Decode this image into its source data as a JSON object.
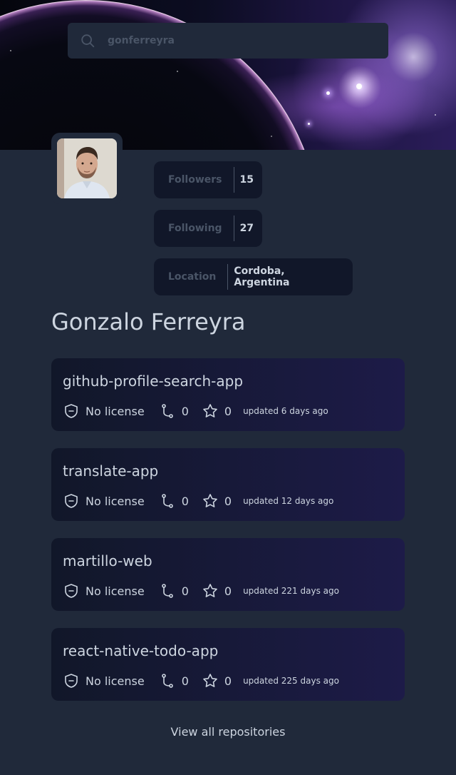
{
  "search": {
    "value": "gonferreyra",
    "placeholder": "gonferreyra"
  },
  "profile": {
    "name": "Gonzalo Ferreyra",
    "stats": [
      {
        "label": "Followers",
        "value": "15"
      },
      {
        "label": "Following",
        "value": "27"
      },
      {
        "label": "Location",
        "value": "Cordoba, Argentina"
      }
    ]
  },
  "repos": [
    {
      "name": "github-profile-search-app",
      "license": "No license",
      "forks": "0",
      "stars": "0",
      "updated": "updated 6 days ago"
    },
    {
      "name": "translate-app",
      "license": "No license",
      "forks": "0",
      "stars": "0",
      "updated": "updated 12 days ago"
    },
    {
      "name": "martillo-web",
      "license": "No license",
      "forks": "0",
      "stars": "0",
      "updated": "updated 221 days ago"
    },
    {
      "name": "react-native-todo-app",
      "license": "No license",
      "forks": "0",
      "stars": "0",
      "updated": "updated 225 days ago"
    }
  ],
  "footer": {
    "view_all": "View all repositories"
  },
  "colors": {
    "background": "#20293a",
    "card": "#111729",
    "card_gradient_end": "#1d1b48",
    "text": "#cdd5e0",
    "muted": "#4a5567"
  },
  "icons": {
    "search": "search-icon",
    "license": "license-shield-icon",
    "fork": "fork-icon",
    "star": "star-icon"
  }
}
